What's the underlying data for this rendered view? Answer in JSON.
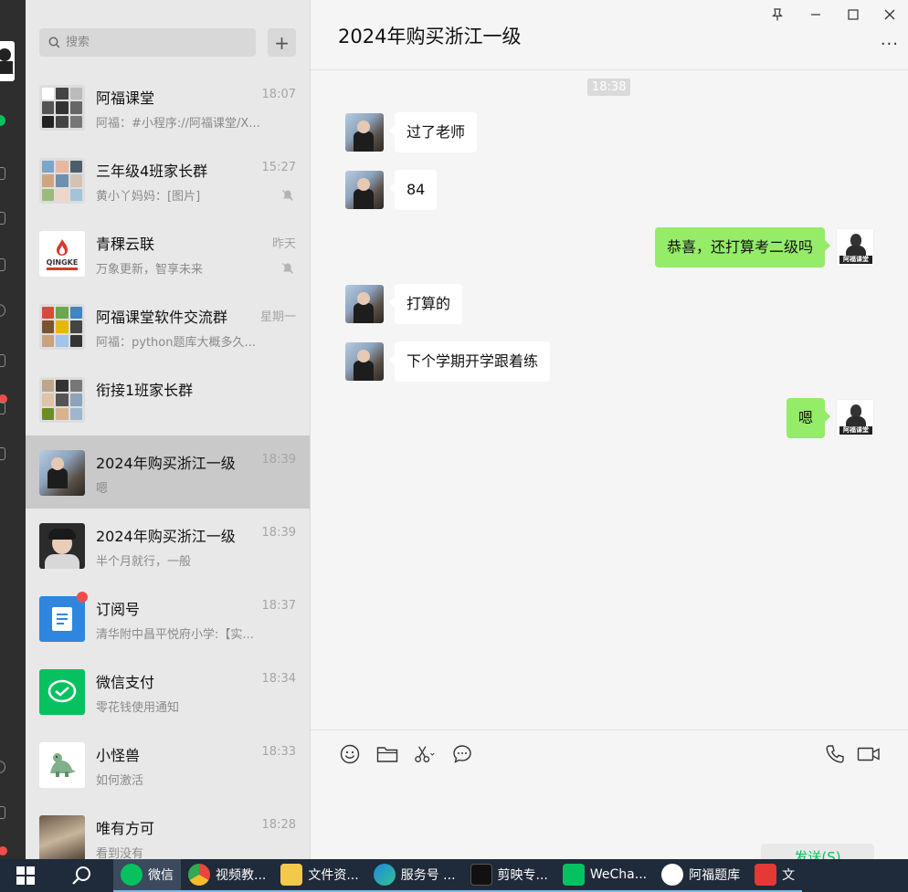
{
  "sidebar_list": {
    "search_placeholder": "搜索",
    "add_label": "+",
    "conversations": [
      {
        "name": "阿福课堂",
        "time": "18:07",
        "preview": "阿福：#小程序://阿福课堂/X...",
        "muted": false,
        "active": false
      },
      {
        "name": "三年级4班家长群",
        "time": "15:27",
        "preview": "黄小丫妈妈：[图片]",
        "muted": true,
        "active": false
      },
      {
        "name": "青稞云联",
        "time": "昨天",
        "preview": "万象更新，智享未来",
        "muted": true,
        "active": false
      },
      {
        "name": "阿福课堂软件交流群",
        "time": "星期一",
        "preview": "阿福：python题库大概多久...",
        "muted": false,
        "active": false
      },
      {
        "name": "衔接1班家长群",
        "time": "",
        "preview": "",
        "muted": false,
        "active": false
      },
      {
        "name": "2024年购买浙江一级",
        "time": "18:39",
        "preview": "嗯",
        "muted": false,
        "active": true
      },
      {
        "name": "2024年购买浙江一级",
        "time": "18:39",
        "preview": "半个月就行，一般",
        "muted": false,
        "active": false
      },
      {
        "name": "订阅号",
        "time": "18:37",
        "preview": "清华附中昌平悦府小学:【实...",
        "muted": false,
        "active": false
      },
      {
        "name": "微信支付",
        "time": "18:34",
        "preview": "零花钱使用通知",
        "muted": false,
        "active": false
      },
      {
        "name": "小怪兽",
        "time": "18:33",
        "preview": "如何激活",
        "muted": false,
        "active": false
      },
      {
        "name": "唯有方可",
        "time": "18:28",
        "preview": "看到没有",
        "muted": false,
        "active": false
      }
    ],
    "qingke_logo_text": "QINGKE"
  },
  "chat": {
    "title": "2024年购买浙江一级",
    "more_label": "···",
    "time_tag": "18:38",
    "messages": [
      {
        "direction": "in",
        "text": "过了老师"
      },
      {
        "direction": "in",
        "text": "84"
      },
      {
        "direction": "out",
        "text": "恭喜，还打算考二级吗"
      },
      {
        "direction": "in",
        "text": "打算的"
      },
      {
        "direction": "in",
        "text": "下个学期开学跟着练"
      },
      {
        "direction": "out",
        "text": "嗯"
      }
    ],
    "avatar_label": "阿福课堂",
    "send_label": "发送(S)"
  },
  "taskbar": {
    "items": [
      {
        "label": "微信",
        "color": "#07c160"
      },
      {
        "label": "视频教...",
        "color": "#e8453c"
      },
      {
        "label": "文件资...",
        "color": "#f2c94c"
      },
      {
        "label": "服务号 ...",
        "color": "#1e88e5"
      },
      {
        "label": "剪映专...",
        "color": "#111111"
      },
      {
        "label": "WeCha...",
        "color": "#07c160"
      },
      {
        "label": "阿福题库",
        "color": "#ffffff"
      },
      {
        "label": "文",
        "color": "#e53935"
      }
    ]
  },
  "colors": {
    "accent_green": "#07c160",
    "bubble_green": "#95ec69",
    "badge_red": "#f14b4b"
  }
}
